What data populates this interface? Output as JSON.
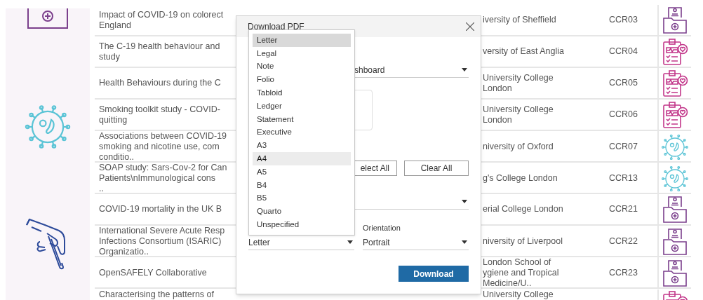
{
  "table": {
    "rows": [
      {
        "title_lines": [
          "Impact of COVID-19 on colorect",
          "England"
        ],
        "institution_lines": [
          "iversity of Sheffield"
        ],
        "code": "CCR03",
        "kind": "folder"
      },
      {
        "title_lines": [
          "The C-19 health behaviour and",
          "study"
        ],
        "institution_lines": [
          "versity of East Anglia"
        ],
        "code": "CCR04",
        "kind": "clipboard"
      },
      {
        "title_lines": [
          "Health Behaviours during the C"
        ],
        "institution_lines": [
          "University College",
          "London"
        ],
        "code": "CCR05",
        "kind": "clipboard"
      },
      {
        "title_lines": [
          "Smoking toolkit study - COVID-",
          "quitting"
        ],
        "institution_lines": [
          "University College",
          "London"
        ],
        "code": "CCR06",
        "kind": "clipboard"
      },
      {
        "title_lines": [
          "Associations between COVID-19",
          "smoking and nicotine use, com",
          "conditio.."
        ],
        "institution_lines": [
          "niversity of Oxford"
        ],
        "code": "CCR07",
        "kind": "virus"
      },
      {
        "title_lines": [
          "SOAP study: Sars-Cov-2 for Can",
          "Patients\\nImmunological cons",
          ".."
        ],
        "institution_lines": [
          "g's College London"
        ],
        "code": "CCR13",
        "kind": "virus"
      },
      {
        "title_lines": [
          "COVID-19 mortality in the UK B"
        ],
        "institution_lines": [
          "erial College London"
        ],
        "code": "CCR21",
        "kind": "folder"
      },
      {
        "title_lines": [
          "International Severe Acute Resp",
          "Infections Consortium (ISARIC)",
          "Organizatio.."
        ],
        "institution_lines": [
          "niversity of Liverpool"
        ],
        "code": "CCR22",
        "kind": "folder"
      },
      {
        "title_lines": [
          "OpenSAFELY Collaborative"
        ],
        "institution_lines": [
          "London School of",
          "ygiene and Tropical",
          "Medicine/U.."
        ],
        "code": "CCR23",
        "kind": "folder"
      },
      {
        "title_lines": [
          "Characterising the patterns of"
        ],
        "institution_lines": [
          "University College"
        ],
        "code": "",
        "kind": "clipboard"
      }
    ]
  },
  "dialog": {
    "title": "Download PDF",
    "content_select": {
      "value": "shboard"
    },
    "select_all_button": "elect All",
    "clear_all_button": "Clear All",
    "paper_size": {
      "value": "Letter",
      "options": [
        {
          "label": "Letter",
          "selected": true,
          "hovered": false
        },
        {
          "label": "Legal",
          "selected": false,
          "hovered": false
        },
        {
          "label": "Note",
          "selected": false,
          "hovered": false
        },
        {
          "label": "Folio",
          "selected": false,
          "hovered": false
        },
        {
          "label": "Tabloid",
          "selected": false,
          "hovered": false
        },
        {
          "label": "Ledger",
          "selected": false,
          "hovered": false
        },
        {
          "label": "Statement",
          "selected": false,
          "hovered": false
        },
        {
          "label": "Executive",
          "selected": false,
          "hovered": false
        },
        {
          "label": "A3",
          "selected": false,
          "hovered": false
        },
        {
          "label": "A4",
          "selected": false,
          "hovered": true
        },
        {
          "label": "A5",
          "selected": false,
          "hovered": false
        },
        {
          "label": "B4",
          "selected": false,
          "hovered": false
        },
        {
          "label": "B5",
          "selected": false,
          "hovered": false
        },
        {
          "label": "Quarto",
          "selected": false,
          "hovered": false
        },
        {
          "label": "Unspecified",
          "selected": false,
          "hovered": false
        }
      ]
    },
    "orientation": {
      "label": "Orientation",
      "value": "Portrait"
    },
    "download_button": "Download"
  }
}
